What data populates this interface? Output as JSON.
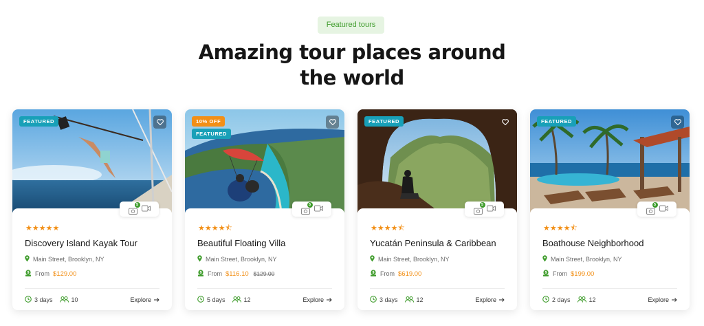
{
  "section": {
    "badge": "Featured tours",
    "title_line1": "Amazing tour places around",
    "title_line2": "the world"
  },
  "colors": {
    "accent_green": "#3f9c2c",
    "accent_orange": "#f28f16",
    "tag_teal": "#18a0b8"
  },
  "labels": {
    "from": "From",
    "explore": "Explore",
    "featured": "FEATURED",
    "photo_count": "5"
  },
  "tours": [
    {
      "tags": [
        "FEATURED"
      ],
      "rating": 5,
      "stars": "★★★★★",
      "title": "Discovery Island Kayak Tour",
      "location": "Main Street, Brooklyn, NY",
      "price": "$129.00",
      "old_price": "",
      "duration": "3 days",
      "people": "10"
    },
    {
      "tags": [
        "10% OFF",
        "FEATURED"
      ],
      "rating": 4.5,
      "stars": "★★★★⯪",
      "title": "Beautiful Floating Villa",
      "location": "Main Street, Brooklyn, NY",
      "price": "$116.10",
      "old_price": "$129.00",
      "duration": "5 days",
      "people": "12"
    },
    {
      "tags": [
        "FEATURED"
      ],
      "rating": 4.5,
      "stars": "★★★★⯪",
      "title": "Yucatán Peninsula & Caribbean",
      "location": "Main Street, Brooklyn, NY",
      "price": "$619.00",
      "old_price": "",
      "duration": "3 days",
      "people": "12"
    },
    {
      "tags": [
        "FEATURED"
      ],
      "rating": 4.5,
      "stars": "★★★★⯪",
      "title": "Boathouse Neighborhood",
      "location": "Main Street, Brooklyn, NY",
      "price": "$199.00",
      "old_price": "",
      "duration": "2 days",
      "people": "12"
    }
  ]
}
